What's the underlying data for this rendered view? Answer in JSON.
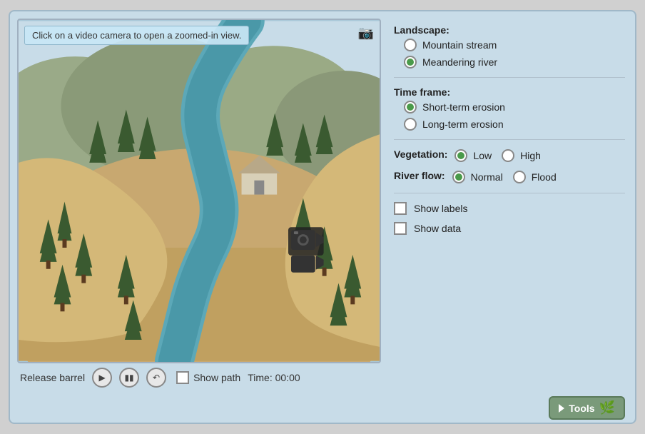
{
  "hint": "Click on a video camera to open a zoomed-in view.",
  "landscape": {
    "title": "Landscape:",
    "options": [
      {
        "label": "Mountain stream",
        "selected": false
      },
      {
        "label": "Meandering river",
        "selected": true
      }
    ]
  },
  "timeframe": {
    "title": "Time frame:",
    "options": [
      {
        "label": "Short-term erosion",
        "selected": true
      },
      {
        "label": "Long-term erosion",
        "selected": false
      }
    ]
  },
  "vegetation": {
    "title": "Vegetation:",
    "options": [
      {
        "label": "Low",
        "selected": true
      },
      {
        "label": "High",
        "selected": false
      }
    ]
  },
  "riverflow": {
    "title": "River flow:",
    "options": [
      {
        "label": "Normal",
        "selected": true
      },
      {
        "label": "Flood",
        "selected": false
      }
    ]
  },
  "checkboxes": [
    {
      "label": "Show labels",
      "checked": false
    },
    {
      "label": "Show data",
      "checked": false
    }
  ],
  "controls": {
    "release_label": "Release barrel",
    "show_path_label": "Show path",
    "time_label": "Time: 00:00"
  },
  "tools_label": "Tools"
}
